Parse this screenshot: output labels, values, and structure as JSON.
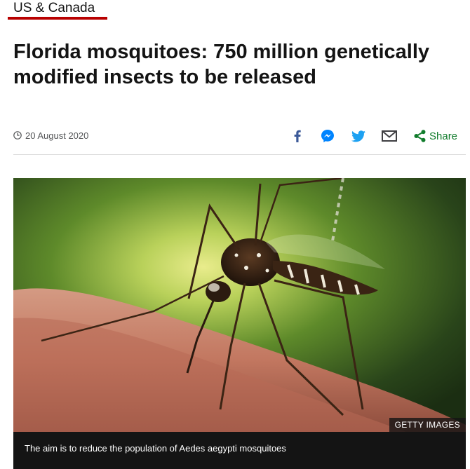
{
  "section": {
    "label": "US & Canada",
    "accent_color": "#b80000"
  },
  "article": {
    "headline": "Florida mosquitoes: 750 million genetically modified insects to be released",
    "date": "20 August 2020"
  },
  "share": {
    "icons": [
      "facebook-icon",
      "messenger-icon",
      "twitter-icon",
      "email-icon",
      "share-icon"
    ],
    "share_label": "Share",
    "facebook_color": "#3b5998",
    "messenger_color": "#0084ff",
    "twitter_color": "#1da1f2",
    "email_color": "#3f3f42",
    "share_color": "#117c2c"
  },
  "image": {
    "credit": "GETTY IMAGES",
    "caption": "The aim is to reduce the population of Aedes aegypti mosquitoes"
  }
}
